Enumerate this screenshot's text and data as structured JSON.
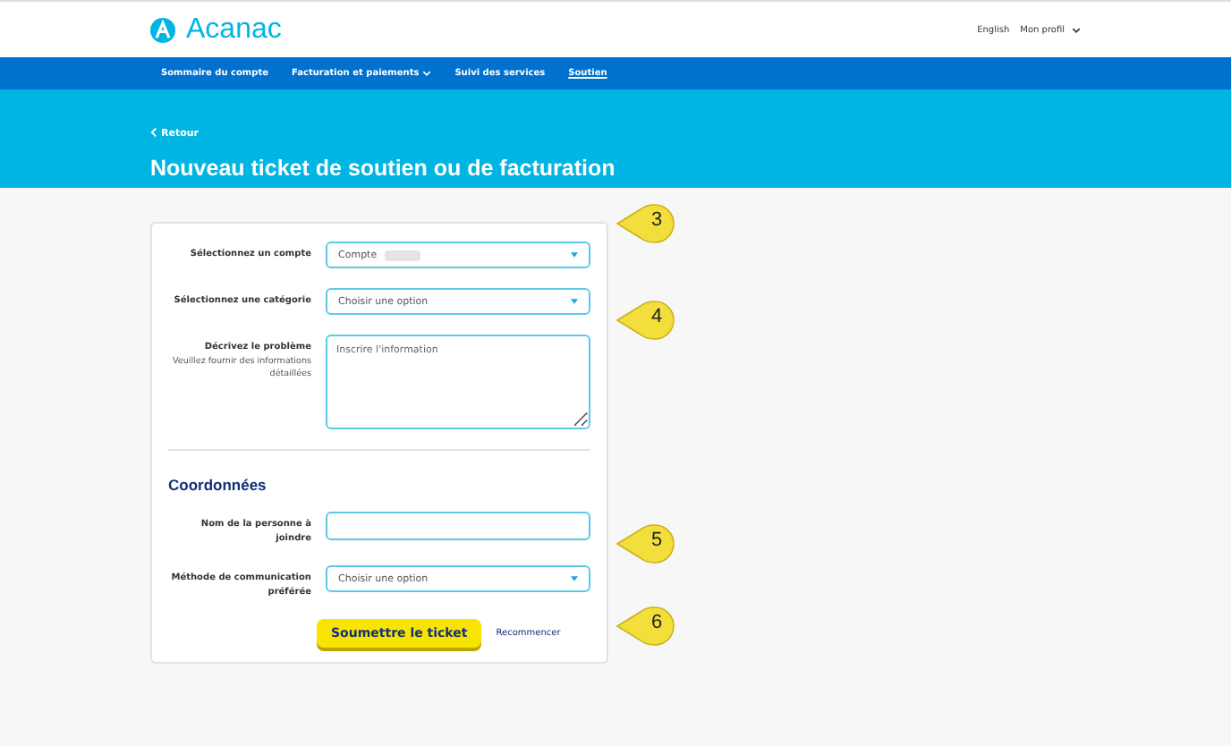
{
  "header": {
    "logo": "Acanac",
    "links": [
      {
        "label": "English",
        "dropdown": false
      },
      {
        "label": "Mon profil",
        "dropdown": true
      }
    ]
  },
  "nav": [
    {
      "label": "Sommaire du compte",
      "dropdown": false,
      "selected": false
    },
    {
      "label": "Facturation et paiements",
      "dropdown": true,
      "selected": false
    },
    {
      "label": "Suivi des services",
      "dropdown": false,
      "selected": false
    },
    {
      "label": "Soutien",
      "dropdown": false,
      "selected": true
    }
  ],
  "banner": {
    "back": "Retour",
    "title": "Nouveau ticket de soutien ou de facturation"
  },
  "form": {
    "fields": [
      {
        "kind": "select",
        "label": "Sélectionnez un compte",
        "value": "Compte",
        "redacted": true
      },
      {
        "kind": "select",
        "label": "Sélectionnez une catégorie",
        "value": "Choisir une option",
        "redacted": false
      },
      {
        "kind": "textarea",
        "label": "Décrivez le problème",
        "hint": "Veuillez fournir des informations détaillées",
        "placeholder": "Inscrire l'information"
      }
    ],
    "section": "Coordonnées",
    "contact_fields": [
      {
        "kind": "input",
        "label": "Nom de la personne à joindre"
      },
      {
        "kind": "select",
        "label": "Méthode de communication préférée",
        "value": "Choisir une option",
        "redacted": false
      }
    ],
    "submit": "Soumettre le ticket",
    "reset": "Recommencer"
  },
  "callouts": [
    {
      "number": "3"
    },
    {
      "number": "4"
    },
    {
      "number": "5"
    },
    {
      "number": "6"
    }
  ]
}
